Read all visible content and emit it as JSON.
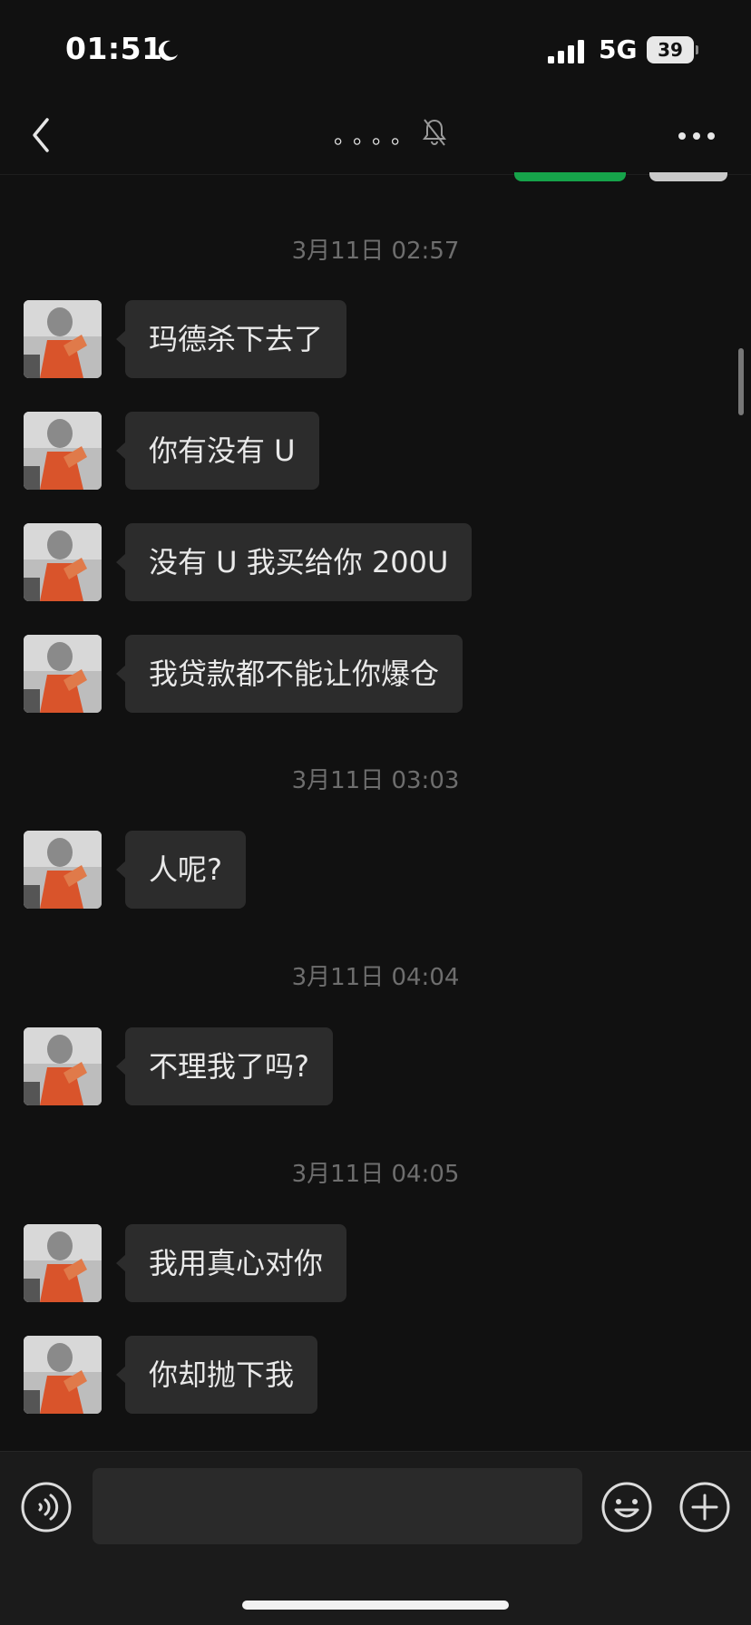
{
  "status_bar": {
    "time": "01:51",
    "network": "5G",
    "battery": "39",
    "moon_icon": "moon-icon",
    "signal_icon": "signal-icon"
  },
  "nav": {
    "title": "。。。。",
    "back_icon": "chevron-left-icon",
    "mute_icon": "bell-slash-icon",
    "more_icon": "ellipsis-icon"
  },
  "messages": [
    {
      "type": "time",
      "text": "3月11日 02:57"
    },
    {
      "type": "text",
      "text": "玛德杀下去了"
    },
    {
      "type": "text",
      "text": "你有没有 U"
    },
    {
      "type": "text",
      "text": "没有 U 我买给你 200U"
    },
    {
      "type": "text",
      "text": "我贷款都不能让你爆仓"
    },
    {
      "type": "time",
      "text": "3月11日 03:03"
    },
    {
      "type": "text",
      "text": "人呢?"
    },
    {
      "type": "time",
      "text": "3月11日 04:04"
    },
    {
      "type": "text",
      "text": "不理我了吗?"
    },
    {
      "type": "time",
      "text": "3月11日 04:05"
    },
    {
      "type": "text",
      "text": "我用真心对你"
    },
    {
      "type": "text",
      "text": "你却抛下我"
    }
  ],
  "input_bar": {
    "placeholder": "",
    "voice_icon": "voice-icon",
    "emoji_icon": "emoji-icon",
    "add_icon": "plus-icon"
  },
  "colors": {
    "background": "#111111",
    "bubble": "#2c2c2c",
    "timestamp": "#6e6e6e",
    "accent_green": "#16a34a"
  }
}
